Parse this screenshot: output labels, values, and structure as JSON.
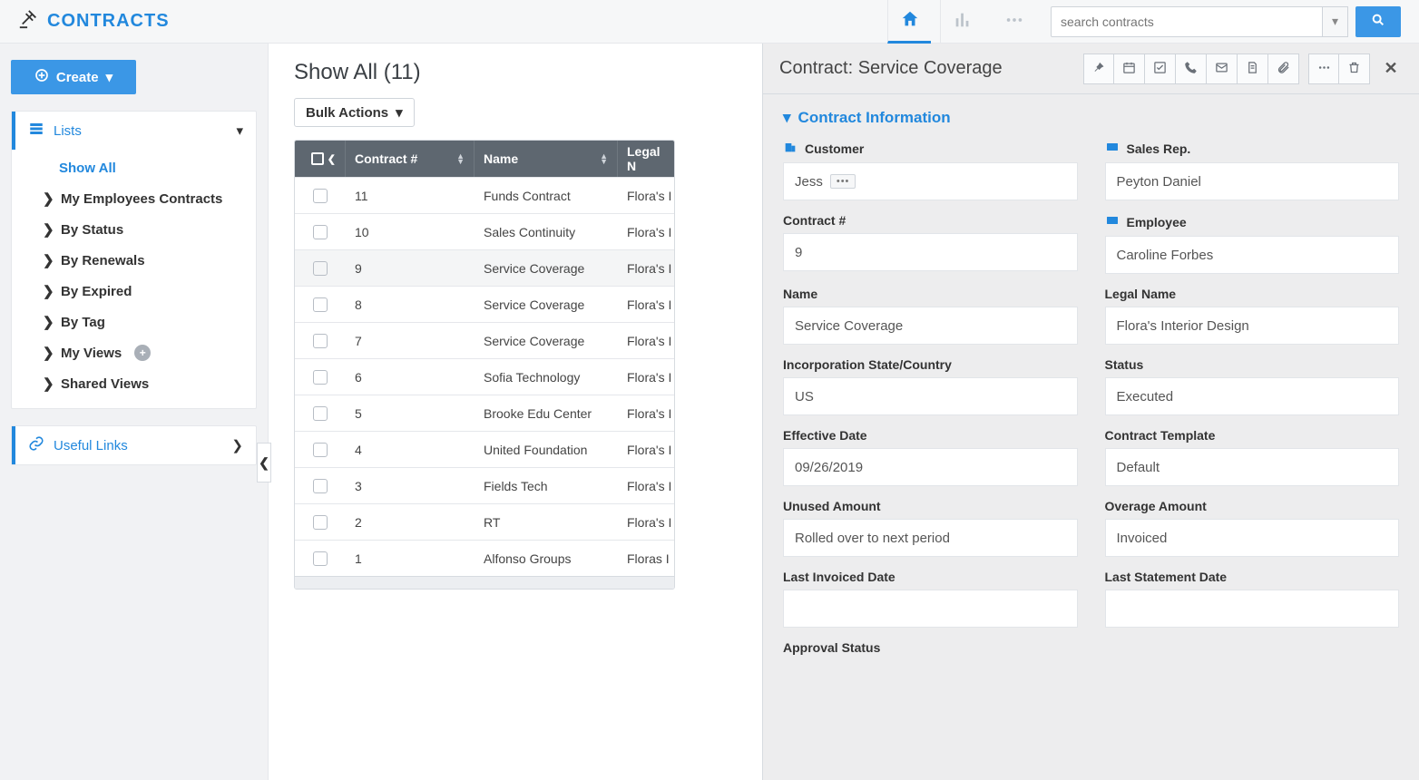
{
  "app": {
    "title": "CONTRACTS"
  },
  "search": {
    "placeholder": "search contracts"
  },
  "sidebar": {
    "create": "Create",
    "lists_label": "Lists",
    "items": [
      {
        "label": "Show All"
      },
      {
        "label": "My Employees Contracts"
      },
      {
        "label": "By Status"
      },
      {
        "label": "By Renewals"
      },
      {
        "label": "By Expired"
      },
      {
        "label": "By Tag"
      },
      {
        "label": "My Views"
      },
      {
        "label": "Shared Views"
      }
    ],
    "useful_links": "Useful Links"
  },
  "main": {
    "title": "Show All  (11)",
    "bulk": "Bulk Actions",
    "columns": {
      "contract_no": "Contract #",
      "name": "Name",
      "legal": "Legal N"
    },
    "rows": [
      {
        "no": "11",
        "name": "Funds Contract",
        "legal": "Flora's I"
      },
      {
        "no": "10",
        "name": "Sales Continuity",
        "legal": "Flora's I"
      },
      {
        "no": "9",
        "name": "Service Coverage",
        "legal": "Flora's I"
      },
      {
        "no": "8",
        "name": "Service Coverage",
        "legal": "Flora's I"
      },
      {
        "no": "7",
        "name": "Service Coverage",
        "legal": "Flora's I"
      },
      {
        "no": "6",
        "name": "Sofia Technology",
        "legal": "Flora's I"
      },
      {
        "no": "5",
        "name": "Brooke Edu Center",
        "legal": "Flora's I"
      },
      {
        "no": "4",
        "name": "United Foundation",
        "legal": "Flora's I"
      },
      {
        "no": "3",
        "name": "Fields Tech",
        "legal": "Flora's I"
      },
      {
        "no": "2",
        "name": "RT",
        "legal": "Flora's I"
      },
      {
        "no": "1",
        "name": "Alfonso Groups",
        "legal": "Floras I"
      }
    ]
  },
  "panel": {
    "title": "Contract: Service Coverage",
    "section": "Contract Information",
    "fields": {
      "customer_label": "Customer",
      "customer": "Jess",
      "salesrep_label": "Sales Rep.",
      "salesrep": "Peyton Daniel",
      "contractno_label": "Contract #",
      "contractno": "9",
      "employee_label": "Employee",
      "employee": "Caroline Forbes",
      "name_label": "Name",
      "name": "Service Coverage",
      "legal_label": "Legal Name",
      "legal": "Flora's Interior Design",
      "incorp_label": "Incorporation State/Country",
      "incorp": "US",
      "status_label": "Status",
      "status": "Executed",
      "eff_label": "Effective Date",
      "eff": "09/26/2019",
      "tpl_label": "Contract Template",
      "tpl": "Default",
      "unused_label": "Unused Amount",
      "unused": "Rolled over to next period",
      "overage_label": "Overage Amount",
      "overage": "Invoiced",
      "lastinv_label": "Last Invoiced Date",
      "lastinv": "",
      "laststmt_label": "Last Statement Date",
      "laststmt": "",
      "approval_label": "Approval Status"
    }
  }
}
